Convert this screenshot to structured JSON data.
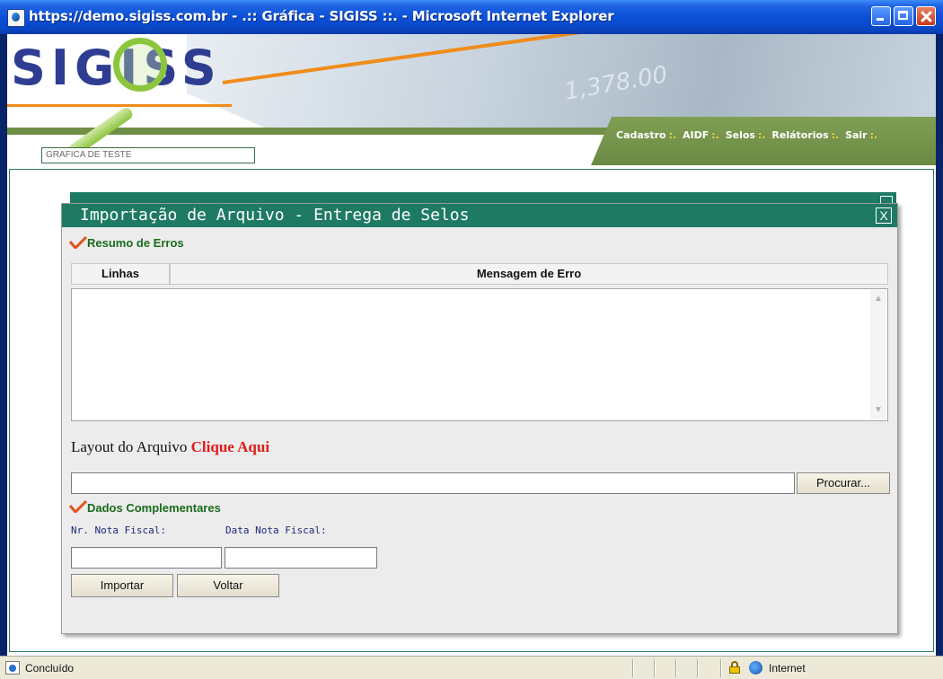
{
  "window": {
    "title": "https://demo.sigiss.com.br - .:: Gráfica - SIGISS ::. - Microsoft Internet Explorer"
  },
  "header": {
    "logo": "SIGISS",
    "banner_digits": "1,378.00",
    "user_box": "GRAFICA DE TESTE",
    "menu": [
      "Cadastro",
      "AIDF",
      "Selos",
      "Relátorios",
      "Sair"
    ],
    "menu_separator": ":.",
    "colors": {
      "green": "#1e7a62",
      "menu_green": "#6f8f46",
      "accent_orange": "#f08c1a",
      "logo_blue": "#2e3c92"
    }
  },
  "modal": {
    "title": "Importação de Arquivo - Entrega de Selos",
    "close": "X",
    "errors_section": "Resumo de Erros",
    "columns": [
      "Linhas",
      "Mensagem de Erro"
    ],
    "rows": [],
    "layout_label": "Layout do Arquivo",
    "layout_link": "Clique Aqui",
    "file_value": "",
    "browse_button": "Procurar...",
    "extra_section": "Dados Complementares",
    "invoice_number_label": "Nr. Nota Fiscal:",
    "invoice_date_label": "Data Nota Fiscal:",
    "invoice_number_value": "",
    "invoice_date_value": "",
    "import_button": "Importar",
    "back_button": "Voltar"
  },
  "statusbar": {
    "status": "Concluído",
    "zone": "Internet"
  }
}
